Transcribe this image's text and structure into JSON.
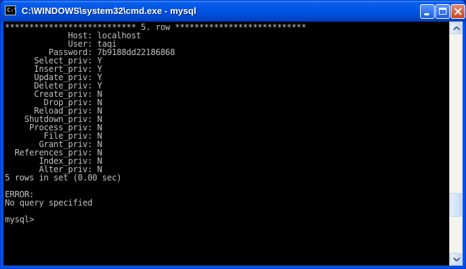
{
  "window": {
    "title": "C:\\WINDOWS\\system32\\cmd.exe - mysql",
    "icon_text": "C:\\",
    "icon": "console-icon",
    "buttons": [
      "minimize-icon",
      "maximize-icon",
      "close-icon"
    ]
  },
  "console": {
    "lines": [
      "*************************** 5. row ***************************",
      "             Host: localhost",
      "             User: taqi",
      "         Password: 7b9188dd22186868",
      "      Select_priv: Y",
      "      Insert_priv: Y",
      "      Update_priv: Y",
      "      Delete_priv: Y",
      "      Create_priv: N",
      "        Drop_priv: N",
      "      Reload_priv: N",
      "    Shutdown_priv: N",
      "     Process_priv: N",
      "        File_priv: N",
      "       Grant_priv: N",
      "  References_priv: N",
      "       Index_priv: N",
      "       Alter_priv: N",
      "5 rows in set (0.00 sec)",
      "",
      "ERROR:",
      "No query specified",
      "",
      "mysql>"
    ]
  },
  "colors": {
    "title_bar": "#0054E3",
    "console_bg": "#000000",
    "console_fg": "#C0C0C0"
  }
}
